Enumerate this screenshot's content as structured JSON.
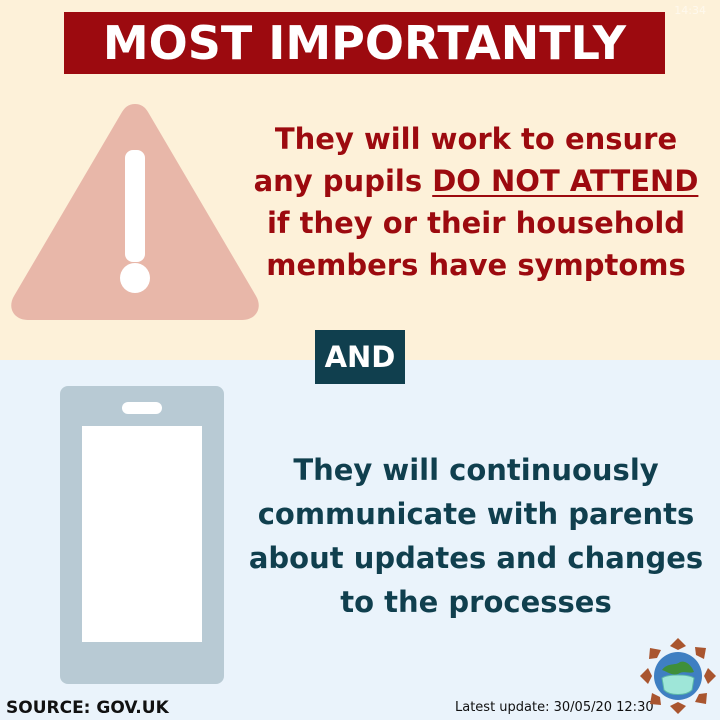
{
  "header": {
    "title": "MOST IMPORTANTLY",
    "stamp": "14:34"
  },
  "top_section": {
    "icon": "warning-triangle-icon",
    "message_lines": [
      "They will work to ensure",
      "any pupils ",
      "DO NOT ATTEND",
      "if they or their household",
      "members have symptoms"
    ]
  },
  "divider": {
    "label": "AND"
  },
  "bottom_section": {
    "icon": "smartphone-icon",
    "message_lines": [
      "They will continuously",
      "communicate with parents",
      "about updates and changes",
      "to the processes"
    ]
  },
  "footer": {
    "source": "SOURCE: GOV.UK",
    "updated": "Latest update: 30/05/20 12:30",
    "logo": "globe-with-mask-logo"
  },
  "colors": {
    "top_background": "#fdf1d9",
    "bottom_background": "#eaf3fb",
    "warning_red": "#9c0a0f",
    "dark_teal": "#103f4e",
    "triangle_fill": "#e8b7a9",
    "phone_fill": "#b8cad4"
  }
}
